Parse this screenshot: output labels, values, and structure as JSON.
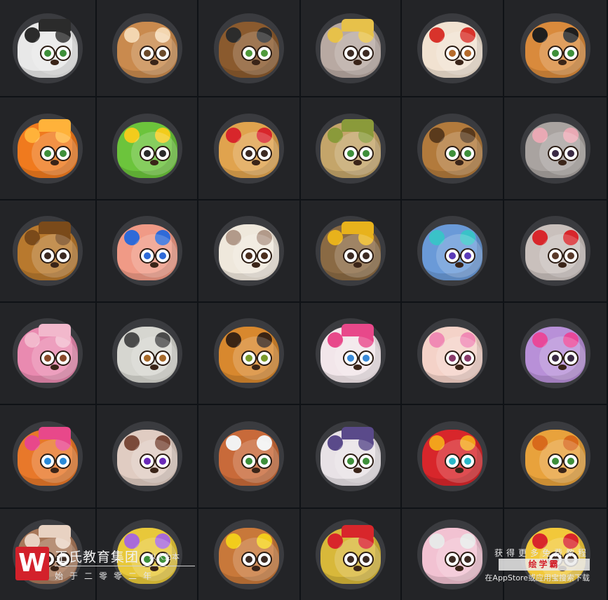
{
  "grid": {
    "tiles": [
      {
        "animal": "zebra-avatar",
        "color": "#e8e8e8",
        "accent": "#2b2b2b",
        "iris": "#3e8f3a"
      },
      {
        "animal": "antelope-avatar",
        "color": "#c98a4e",
        "accent": "#f3d6b0",
        "iris": "#6b4a2a"
      },
      {
        "animal": "bear-scholar-avatar",
        "color": "#8a5a2e",
        "accent": "#2c2c2c",
        "iris": "#4f9a3c"
      },
      {
        "animal": "koala-monocle-avatar",
        "color": "#b8a9a2",
        "accent": "#e7c14a",
        "iris": "#3c2a22"
      },
      {
        "animal": "rooster-avatar",
        "color": "#f1e2d1",
        "accent": "#d8332b",
        "iris": "#b56b2c"
      },
      {
        "animal": "gentleman-hamster-avatar",
        "color": "#d98a3c",
        "accent": "#1e1e1e",
        "iris": "#3e8f3a"
      },
      {
        "animal": "fire-creature-avatar",
        "color": "#f07a1e",
        "accent": "#ffb23a",
        "iris": "#3e8f3a"
      },
      {
        "animal": "frog-king-avatar",
        "color": "#6cc43c",
        "accent": "#f2cc1c",
        "iris": "#2a2a2a"
      },
      {
        "animal": "santa-mouse-avatar",
        "color": "#e0a34e",
        "accent": "#d8262b",
        "iris": "#3c2a22"
      },
      {
        "animal": "tree-sprite-avatar",
        "color": "#c4a56a",
        "accent": "#8a9a3a",
        "iris": "#3e8f3a"
      },
      {
        "animal": "brown-bear-avatar",
        "color": "#b27a3c",
        "accent": "#5a3a1c",
        "iris": "#3e8f3a"
      },
      {
        "animal": "grey-mouse-avatar",
        "color": "#a9a3a0",
        "accent": "#e9a9b4",
        "iris": "#3a2a44"
      },
      {
        "animal": "capybara-avatar",
        "color": "#b8792e",
        "accent": "#7a4a1a",
        "iris": "#3c2a22"
      },
      {
        "animal": "snail-avatar",
        "color": "#f09a86",
        "accent": "#2e6ad8",
        "iris": "#2e6ad8"
      },
      {
        "animal": "ferret-avatar",
        "color": "#efe8dc",
        "accent": "#b29a8a",
        "iris": "#4a2e1e"
      },
      {
        "animal": "sloth-glasses-avatar",
        "color": "#8a6a44",
        "accent": "#e8b21c",
        "iris": "#3c2a22"
      },
      {
        "animal": "crystal-deer-avatar",
        "color": "#6a9ad8",
        "accent": "#3ac2c8",
        "iris": "#5a3ab8"
      },
      {
        "animal": "donkey-bow-avatar",
        "color": "#c9c0bc",
        "accent": "#d8262b",
        "iris": "#5a3a2a"
      },
      {
        "animal": "pink-sheep-avatar",
        "color": "#e98ab0",
        "accent": "#f2b8cc",
        "iris": "#8a4a2a"
      },
      {
        "animal": "lemur-avatar",
        "color": "#d6d6d0",
        "accent": "#4a4a4a",
        "iris": "#a86a2a"
      },
      {
        "animal": "tiger-avatar",
        "color": "#d8882e",
        "accent": "#3a2414",
        "iris": "#7a9a2a"
      },
      {
        "animal": "bunny-hat-avatar",
        "color": "#f2e6ea",
        "accent": "#e8488a",
        "iris": "#3a8ad8"
      },
      {
        "animal": "flower-sheep-avatar",
        "color": "#f4d2c8",
        "accent": "#f08ab4",
        "iris": "#8a3a6a"
      },
      {
        "animal": "hippo-bow-avatar",
        "color": "#b890d8",
        "accent": "#e8489a",
        "iris": "#3a2a44"
      },
      {
        "animal": "frilled-lizard-avatar",
        "color": "#e8782a",
        "accent": "#e8488a",
        "iris": "#2a8ad8"
      },
      {
        "animal": "raccoon-dog-avatar",
        "color": "#e0ccc2",
        "accent": "#7a4a3a",
        "iris": "#6a2ab8"
      },
      {
        "animal": "nurse-panda-avatar",
        "color": "#c86a3a",
        "accent": "#f2f2f2",
        "iris": "#3e8f3a"
      },
      {
        "animal": "horse-avatar",
        "color": "#e8e2e6",
        "accent": "#5a4a8a",
        "iris": "#3e8f3a"
      },
      {
        "animal": "red-bird-avatar",
        "color": "#d8262b",
        "accent": "#f2a21c",
        "iris": "#2ab8c8"
      },
      {
        "animal": "lion-cub-avatar",
        "color": "#e8a23c",
        "accent": "#d86a1c",
        "iris": "#3e8f3a"
      },
      {
        "animal": "squirrel-avatar",
        "color": "#a8785a",
        "accent": "#e8d2c2",
        "iris": "#3c2a22"
      },
      {
        "animal": "lavender-flower-avatar",
        "color": "#e8c83a",
        "accent": "#a86ad8",
        "iris": "#3e8f3a"
      },
      {
        "animal": "bulldog-king-avatar",
        "color": "#c8783a",
        "accent": "#f2cc1c",
        "iris": "#3c2a22"
      },
      {
        "animal": "parrot-rooster-avatar",
        "color": "#d8b83a",
        "accent": "#d8262b",
        "iris": "#3c2a22"
      },
      {
        "animal": "pink-bunny-avatar",
        "color": "#f2c2d2",
        "accent": "#e8e8e8",
        "iris": "#3c2a22"
      },
      {
        "animal": "yellow-rooster-avatar",
        "color": "#f2c83a",
        "accent": "#d8262b",
        "iris": "#3c2a22"
      }
    ]
  },
  "watermark": {
    "logo_letter": "W",
    "name": "王氏教育集团",
    "slogan": "以人为本",
    "since": "始于二零零二年",
    "get_more": "获得更多免费教程",
    "brand": "绘学霸",
    "store_line": "在AppStore或应用宝搜索下载"
  }
}
